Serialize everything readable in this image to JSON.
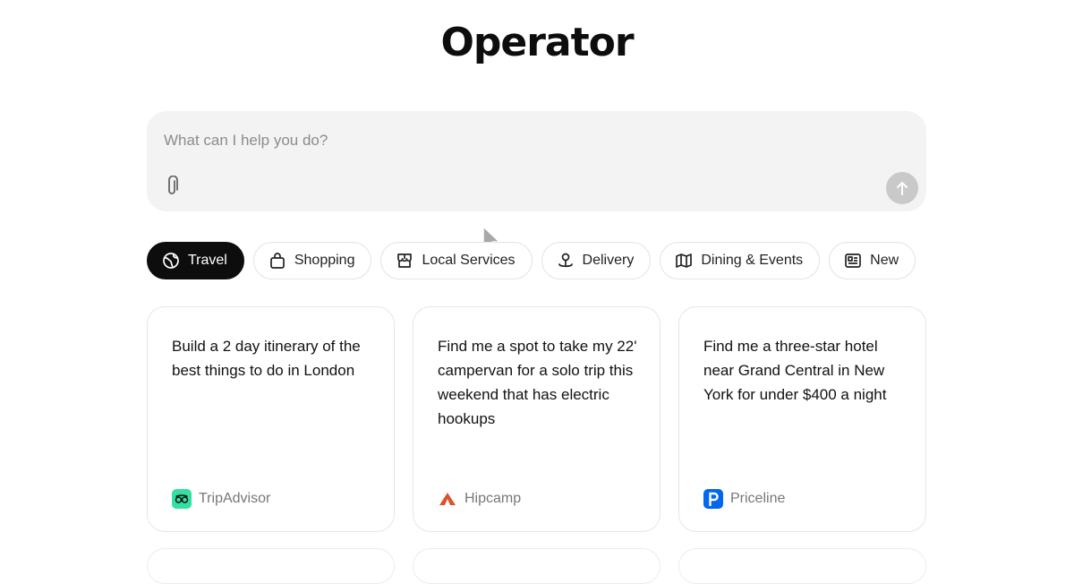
{
  "app": {
    "title": "Operator"
  },
  "composer": {
    "placeholder": "What can I help you do?"
  },
  "categories": [
    {
      "label": "Travel",
      "icon": "globe-icon",
      "active": true
    },
    {
      "label": "Shopping",
      "icon": "shopping-bag-icon",
      "active": false
    },
    {
      "label": "Local Services",
      "icon": "storefront-icon",
      "active": false
    },
    {
      "label": "Delivery",
      "icon": "map-pin-icon",
      "active": false
    },
    {
      "label": "Dining & Events",
      "icon": "map-icon",
      "active": false
    },
    {
      "label": "New",
      "icon": "newspaper-icon",
      "active": false
    }
  ],
  "cards": [
    {
      "prompt": "Build a 2 day itinerary of the best things to do in London",
      "source": "TripAdvisor",
      "logo_color": "#34e0a1"
    },
    {
      "prompt": "Find me a spot to take my 22' campervan for a solo trip this weekend that has electric hookups",
      "source": "Hipcamp",
      "logo_color": "#d9532b"
    },
    {
      "prompt": "Find me a three-star hotel near Grand Central in New York for under $400 a night",
      "source": "Priceline",
      "logo_color": "#0068ef"
    }
  ],
  "colors": {
    "accent": "#0d0d0d",
    "composer_bg": "#f3f3f3",
    "send_disabled": "#c9c9c9"
  }
}
